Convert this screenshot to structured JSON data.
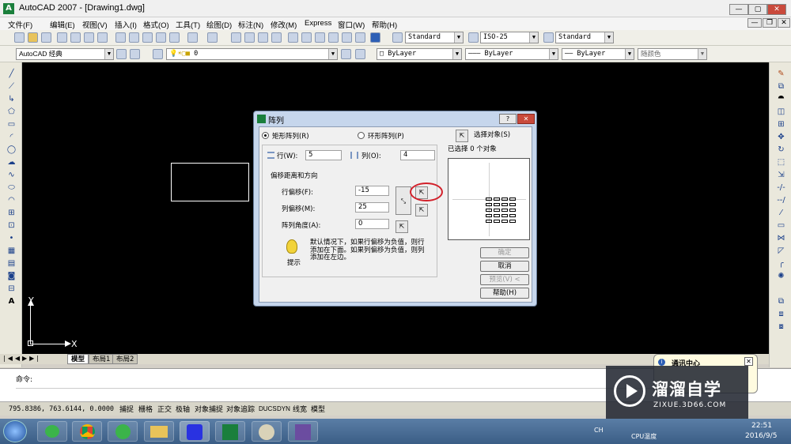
{
  "window": {
    "title": "AutoCAD 2007 - [Drawing1.dwg]",
    "app_icon_glyph": "A",
    "controls": [
      "—",
      "▢",
      "✕"
    ],
    "doc_controls": [
      "—",
      "❐",
      "✕"
    ]
  },
  "menu": [
    "文件(F)",
    "编辑(E)",
    "视图(V)",
    "插入(I)",
    "格式(O)",
    "工具(T)",
    "绘图(D)",
    "标注(N)",
    "修改(M)",
    "Express",
    "窗口(W)",
    "帮助(H)"
  ],
  "toolbar1": {
    "combos": [
      "Standard",
      "ISO-25",
      "Standard"
    ]
  },
  "toolbar2": {
    "workspace": "AutoCAD 经典",
    "layer": "0",
    "color": "ByLayer",
    "linetype": "ByLayer",
    "lineweight": "ByLayer",
    "plotstyle": "随颜色"
  },
  "ucs": {
    "y_label": "Y",
    "x_label": "X"
  },
  "layout_tabs": [
    "模型",
    "布局1",
    "布局2"
  ],
  "command": {
    "prompt": "命令:"
  },
  "status": {
    "coords": "795.8386, 763.6144, 0.0000",
    "buttons": [
      "捕捉",
      "栅格",
      "正交",
      "极轴",
      "对象捕捉",
      "对象追踪",
      "DUCS",
      "DYN",
      "线宽",
      "模型"
    ]
  },
  "dialog": {
    "title": "阵列",
    "rect_array": "矩形阵列(R)",
    "polar_array": "环形阵列(P)",
    "select_objects": "选择对象(S)",
    "selected_count": "已选择 0 个对象",
    "rows_label": "行(W):",
    "rows_value": "5",
    "cols_label": "列(O):",
    "cols_value": "4",
    "offset_group": "偏移距离和方向",
    "row_offset_label": "行偏移(F):",
    "row_offset_value": "-15",
    "col_offset_label": "列偏移(M):",
    "col_offset_value": "25",
    "angle_label": "阵列角度(A):",
    "angle_value": "0",
    "tip_text": "默认情况下，如果行偏移为负值，则行添加在下面。如果列偏移为负值，则列添加在左边。",
    "tip_label": "提示",
    "ok": "确定",
    "cancel": "取消",
    "preview": "预览(V) <",
    "help": "帮助(H)"
  },
  "comm_center": {
    "title": "通讯中心"
  },
  "watermark": {
    "brand": "溜溜自学",
    "url": "ZIXUE.3D66.COM"
  },
  "tray": {
    "ime": "CH",
    "cpu": "CPU温度",
    "time": "22:51",
    "date": "2016/9/5"
  }
}
